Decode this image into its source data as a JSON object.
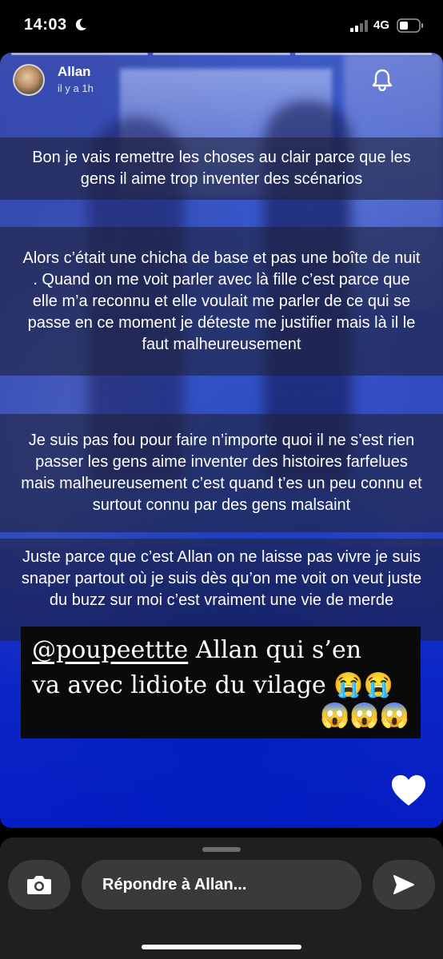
{
  "status_bar": {
    "time": "14:03",
    "network": "4G",
    "icons": [
      "moon-icon",
      "signal-icon",
      "battery-icon"
    ]
  },
  "story": {
    "progress_segments": 3,
    "author": {
      "name": "Allan",
      "time_ago": "il y a 1h"
    },
    "captions": [
      "Bon je vais remettre les choses au clair parce que les gens il aime trop inventer des scénarios",
      "Alors c’était une chicha de base et pas une boîte de nuit . Quand on me voit parler avec là fille c’est parce que elle m’a reconnu et elle voulait me parler de ce qui se passe en ce moment je déteste me justifier mais là il le faut malheureusement",
      "Je suis pas fou pour faire n’importe quoi il ne s’est rien passer les gens aime inventer des histoires farfelues mais malheureusement c’est quand t’es un peu connu et surtout connu par des gens malsaint",
      "Juste parce que c’est Allan on ne laisse pas vivre je suis snaper partout où je suis dès qu’on me voit on veut juste du buzz sur moi c’est vraiment une vie de merde"
    ],
    "sticker": {
      "mention": "@poupeettte",
      "line1_rest": "  Allan qui s’en",
      "line2": "va avec lidiote du vilage ",
      "line2_emojis": "😭😭",
      "line3_emojis": "😱😱😱"
    },
    "icons": {
      "notify": "bell-icon",
      "like": "heart-icon"
    }
  },
  "reply_bar": {
    "placeholder": "Répondre à Allan...",
    "icons": {
      "camera": "camera-icon",
      "send": "send-icon"
    }
  },
  "colors": {
    "story_blue": "#2940b0",
    "caption_band": "#1e223c",
    "reply_bg": "#1f1f1f",
    "pill_bg": "#3a3a3a"
  }
}
